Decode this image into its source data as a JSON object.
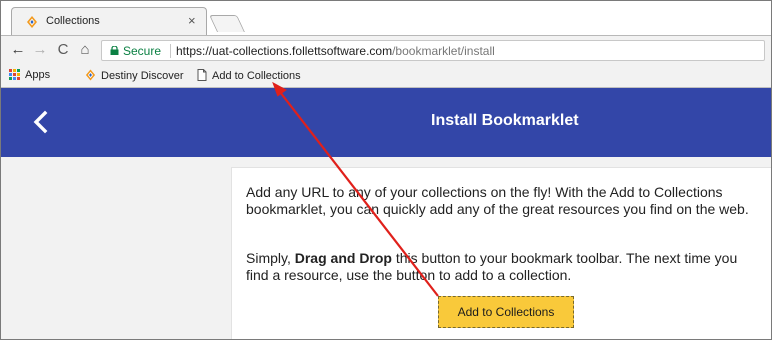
{
  "browser": {
    "tab": {
      "title": "Collections",
      "close_glyph": "×",
      "favicon": "destiny-logo-icon"
    },
    "nav": {
      "back": "←",
      "forward": "→",
      "reload": "C",
      "home": "⌂"
    },
    "omnibox": {
      "secure_label": "Secure",
      "url_scheme_host": "https://uat-collections.follettsoftware.com",
      "url_path": "/bookmarklet/install"
    },
    "bookmarks": [
      {
        "label": "Apps",
        "icon": "apps-grid-icon"
      },
      {
        "label": "Destiny Discover",
        "icon": "destiny-logo-icon"
      },
      {
        "label": "Add to Collections",
        "icon": "page-icon"
      }
    ]
  },
  "page": {
    "title": "Install Bookmarklet",
    "back_icon": "chevron-left-icon",
    "para1": "Add any URL to any of your collections on the fly! With the Add to Collections bookmarklet, you can quickly add any of the great resources you find on the web.",
    "para2_before": "Simply, ",
    "para2_bold": "Drag and Drop",
    "para2_after": " this button to your bookmark toolbar. The next time you find a resource, use the button to add to a collection.",
    "button_label": "Add to Collections"
  },
  "colors": {
    "appbar": "#3346a8",
    "button": "#f9c93a",
    "secure": "#0b8043",
    "annotation_arrow": "#e0201b"
  }
}
